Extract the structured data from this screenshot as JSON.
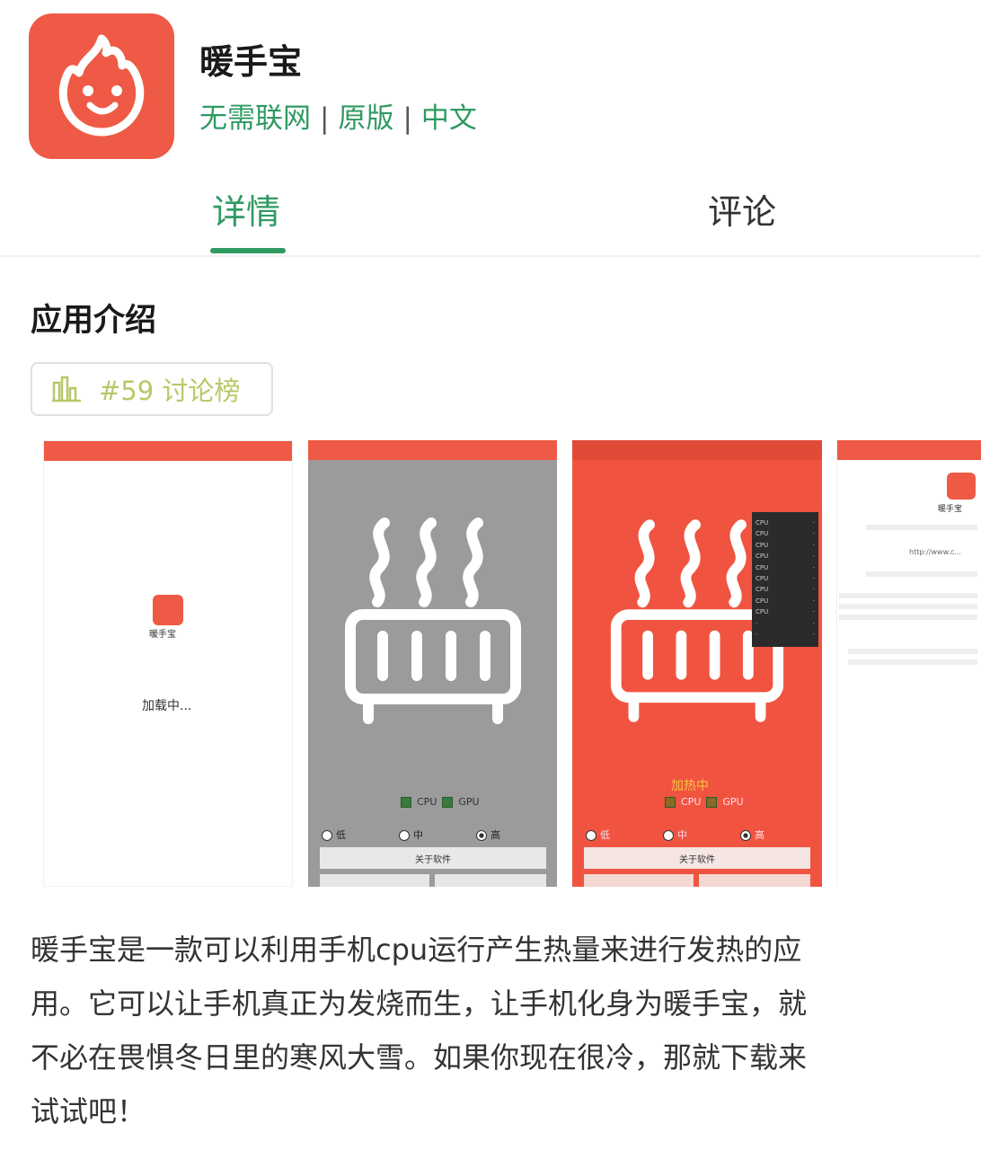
{
  "app": {
    "name": "暖手宝",
    "tags": [
      "无需联网",
      "原版",
      "中文"
    ],
    "separator": "|",
    "brand_color": "#ee5a45",
    "accent_color": "#2f9a62",
    "icon": "flame-smile-icon"
  },
  "tabs": [
    {
      "label": "详情",
      "active": true
    },
    {
      "label": "评论",
      "active": false
    }
  ],
  "section": {
    "title": "应用介绍",
    "rank_badge": {
      "icon": "bar-chart-icon",
      "text": "#59 讨论榜"
    }
  },
  "screenshots": {
    "s1": {
      "app_label": "暖手宝",
      "loading": "加载中..."
    },
    "s2": {
      "cpu": "CPU",
      "gpu": "GPU",
      "radio": [
        "低",
        "中",
        "高"
      ],
      "about": "关于软件"
    },
    "s3": {
      "heating": "加热中",
      "cpu": "CPU",
      "gpu": "GPU",
      "radio": [
        "低",
        "中",
        "高"
      ],
      "about": "关于软件"
    },
    "s4": {
      "app_name": "暖手宝",
      "url": "http://www.c..."
    }
  },
  "description": [
    "暖手宝是一款可以利用手机cpu运行产生热量来进行发热的应",
    "用。它可以让手机真正为发烧而生，让手机化身为暖手宝，就",
    "不必在畏惧冬日里的寒风大雪。如果你现在很冷，那就下载来",
    "试试吧！"
  ]
}
